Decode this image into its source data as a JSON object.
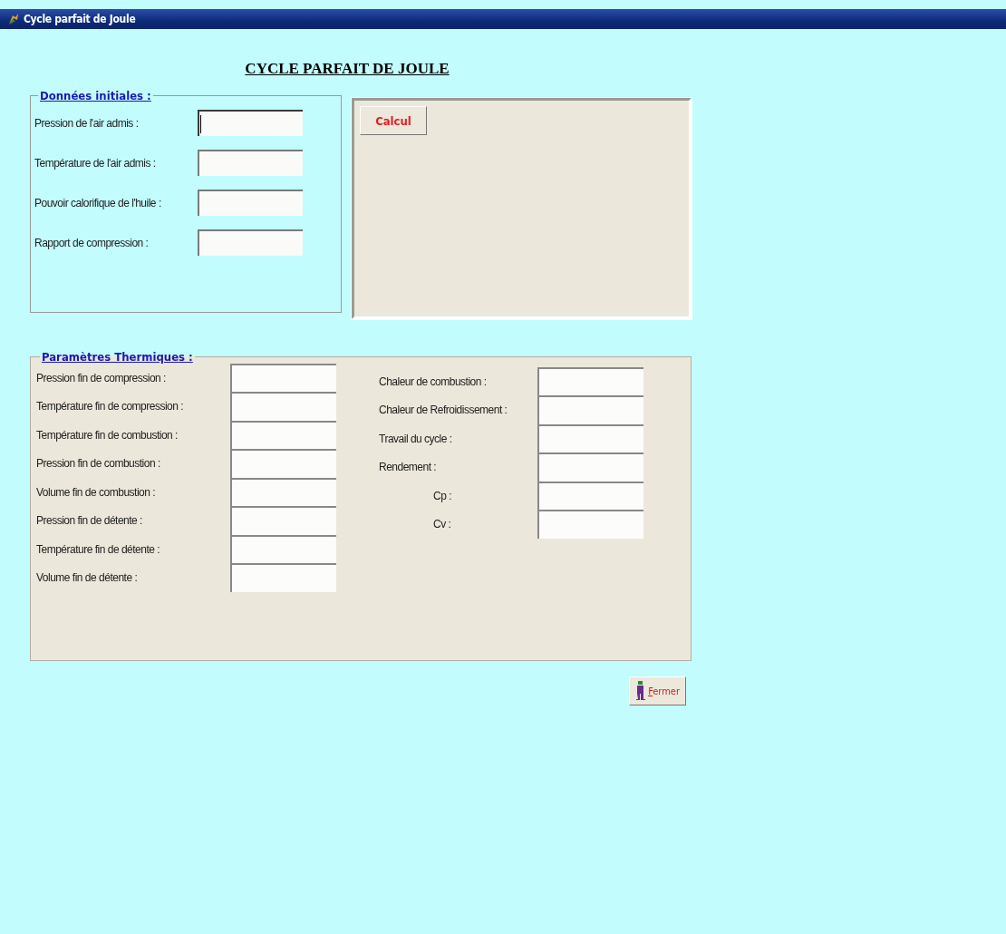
{
  "window": {
    "title": "Cycle parfait de Joule"
  },
  "heading": "CYCLE PARFAIT DE JOULE",
  "initial": {
    "legend": "Données initiales :",
    "fields": [
      {
        "label": "Pression de l'air admis :",
        "focused": true
      },
      {
        "label": "Température de l'air admis :",
        "focused": false
      },
      {
        "label": "Pouvoir calorifique de l'huile :",
        "focused": false
      },
      {
        "label": "Rapport de compression :",
        "focused": false
      }
    ]
  },
  "calc_button": "Calcul",
  "thermal": {
    "legend": "Paramètres Thermiques :",
    "left": [
      {
        "label": "Pression fin de compression :"
      },
      {
        "label": "Température fin de compression :"
      },
      {
        "label": "Température fin de combustion :"
      },
      {
        "label": "Pression fin de combustion :"
      },
      {
        "label": "Volume fin de combustion :"
      },
      {
        "label": "Pression fin de détente :"
      },
      {
        "label": "Température fin de détente :"
      },
      {
        "label": "Volume fin de détente :"
      }
    ],
    "right": [
      {
        "label": "Chaleur de combustion :"
      },
      {
        "label": "Chaleur de Refroidissement :"
      },
      {
        "label": "Travail du cycle :"
      },
      {
        "label": "Rendement :"
      },
      {
        "label": "Cp :"
      },
      {
        "label": "Cv :"
      }
    ]
  },
  "close_button": "Fermer"
}
